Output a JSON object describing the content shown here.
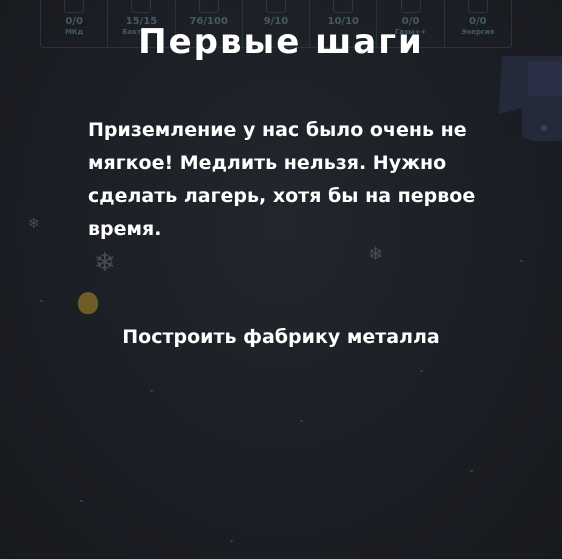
{
  "resources": [
    {
      "value": "0/0",
      "name": "МКд",
      "icon": "energy-cell-icon"
    },
    {
      "value": "15/15",
      "name": "Бактерии",
      "icon": "bacteria-icon"
    },
    {
      "value": "76/100",
      "name": "",
      "icon": "food-icon"
    },
    {
      "value": "9/10",
      "name": "",
      "icon": "molecule-icon"
    },
    {
      "value": "10/10",
      "name": "",
      "icon": "crate-icon"
    },
    {
      "value": "0/0",
      "name": "Газы++",
      "icon": "gas-icon"
    },
    {
      "value": "0/0",
      "name": "Энергия",
      "icon": "lightning-icon"
    }
  ],
  "dialog": {
    "title": "Первые шаги",
    "text": "Приземление у нас было очень не мягкое! Медлить нельзя. Нужно сделать лагерь, хотя бы на первое время.",
    "task": "Построить фабрику металла"
  }
}
